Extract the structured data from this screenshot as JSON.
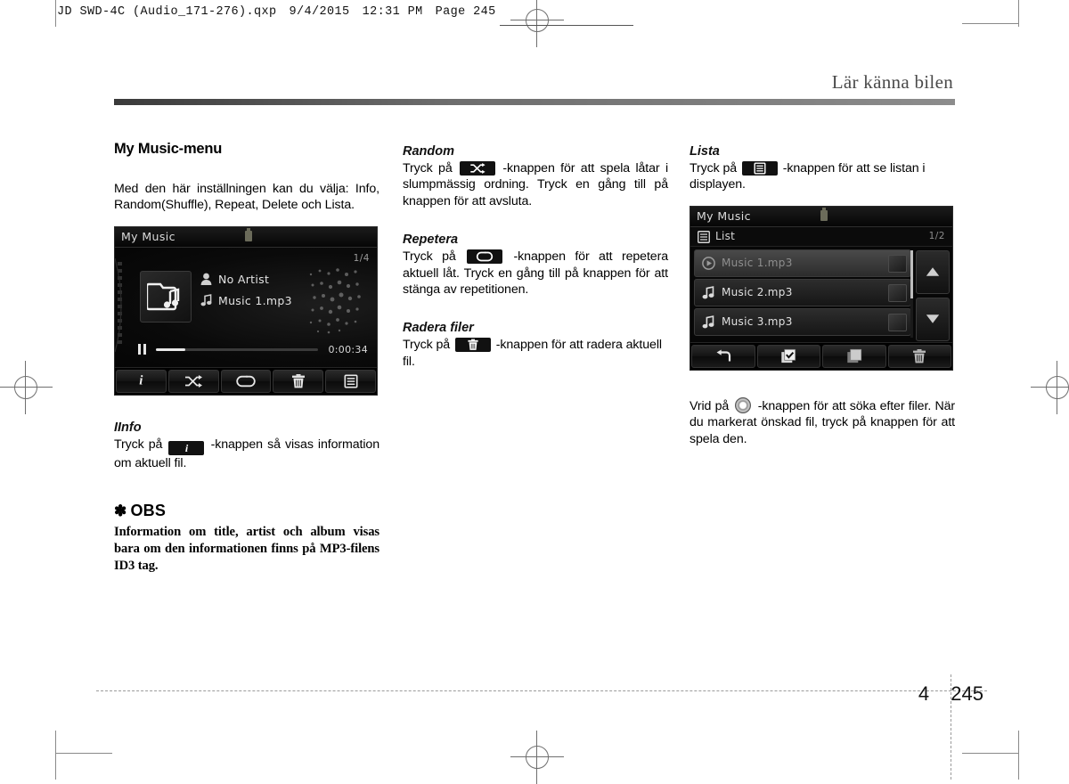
{
  "slug": {
    "file": "JD SWD-4C (Audio_171-276).qxp",
    "date": "9/4/2015",
    "time": "12:31 PM",
    "page": "Page 245"
  },
  "running_head": "Lär känna bilen",
  "columns": {
    "left": {
      "section_title": "My Music-menu",
      "intro": "Med den här inställningen kan du välja: Info, Random(Shuffle), Repeat, Delete och Lista.",
      "info": {
        "heading": "IInfo",
        "text_before": "Tryck på",
        "text_after": "-knappen så visas information om aktuell fil."
      },
      "note": {
        "asterisk": "✽",
        "title": "OBS",
        "body": "Information om title, artist och album visas bara om den informationen finns på MP3-filens ID3 tag."
      }
    },
    "middle": {
      "random": {
        "heading": "Random",
        "text_before": "Tryck på",
        "text_after": "-knappen för att spela låtar i slumpmässig ordning. Tryck en gång till på knappen för att avsluta."
      },
      "repeat": {
        "heading": "Repetera",
        "text_before": "Tryck på",
        "text_after": "-knappen för att repetera aktuell låt. Tryck en gång till på knappen för att stänga av repetitionen."
      },
      "delete": {
        "heading": "Radera filer",
        "text_before": "Tryck på",
        "text_after": "-knappen för att radera aktuell fil."
      }
    },
    "right": {
      "list": {
        "heading": "Lista",
        "text_before": "Tryck på",
        "text_after": "-knappen för att se listan i displayen."
      },
      "knob": {
        "text_before": "Vrid på",
        "text_after": "-knappen för att söka efter filer. När du markerat önskad fil, tryck på knappen för att spela den."
      }
    }
  },
  "player_screen": {
    "title": "My Music",
    "usb_icon": "usb-icon",
    "track_counter": "1/4",
    "artist": "No Artist",
    "track": "Music 1.mp3",
    "elapsed": "0:00:34",
    "state_icon": "pause-icon",
    "buttons": [
      {
        "name": "info-button",
        "icon": "info-icon"
      },
      {
        "name": "shuffle-button",
        "icon": "shuffle-icon"
      },
      {
        "name": "repeat-button",
        "icon": "repeat-icon"
      },
      {
        "name": "delete-button",
        "icon": "trash-icon"
      },
      {
        "name": "list-button",
        "icon": "list-icon"
      }
    ]
  },
  "list_screen": {
    "title": "My Music",
    "usb_icon": "usb-icon",
    "sub_label": "List",
    "sub_icon": "list-icon",
    "page_counter": "1/2",
    "rows": [
      {
        "name": "Music 1.mp3",
        "icon": "play-icon",
        "selected": true
      },
      {
        "name": "Music 2.mp3",
        "icon": "note-icon",
        "selected": false
      },
      {
        "name": "Music 3.mp3",
        "icon": "note-icon",
        "selected": false
      }
    ],
    "scroll_up_icon": "triangle-up-icon",
    "scroll_down_icon": "triangle-down-icon",
    "buttons": [
      {
        "name": "back-button",
        "icon": "back-arrow-icon"
      },
      {
        "name": "select-all-button",
        "icon": "checked-box-icon"
      },
      {
        "name": "deselect-all-button",
        "icon": "empty-box-icon"
      },
      {
        "name": "delete-button",
        "icon": "trash-icon"
      }
    ]
  },
  "footer": {
    "chapter": "4",
    "page": "245"
  }
}
